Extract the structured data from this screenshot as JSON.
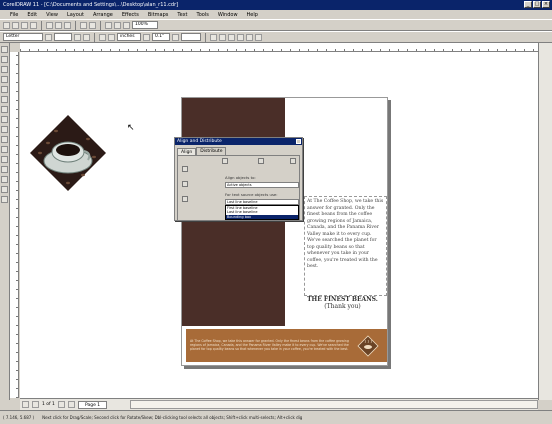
{
  "window": {
    "title": "CorelDRAW 11 - [C:\\Documents and Settings\\...\\Desktop\\alan_r11.cdr]",
    "buttons": [
      "_",
      "□",
      "×"
    ]
  },
  "menu": [
    "File",
    "Edit",
    "View",
    "Layout",
    "Arrange",
    "Effects",
    "Bitmaps",
    "Text",
    "Tools",
    "Window",
    "Help"
  ],
  "toolbar": {
    "zoom": "100%"
  },
  "property_bar": {
    "paper": "Letter",
    "units": "inches",
    "nudge": "0.1\""
  },
  "document": {
    "body_copy": "At The Coffee Shop, we take this answer for granted. Only the finest beans from the coffee growing regions of Jamaica, Canada, and the Panama River Valley make it to every cup. We've searched the planet for top quality beans so that whenever you take in your coffee, you're treated with the best.",
    "headline_1": "THE FINEST BEANS.",
    "headline_2": "(Thank you)",
    "footer_copy": "At The Coffee Shop, we take this answer for granted. Only the finest beans from the coffee growing regions of Jamaica, Canada, and the Panama River Valley make it to every cup. We've searched the planet for top quality beans so that whenever you take in your coffee, you're treated with the best."
  },
  "dialog": {
    "title": "Align and Distribute",
    "tabs": [
      "Align",
      "Distribute"
    ],
    "align_objects_to_label": "Align objects to:",
    "align_objects_to_value": "Active objects",
    "for_text_label": "For text source objects use:",
    "for_text_value": "Last line baseline",
    "options": [
      "First line baseline",
      "Last line baseline",
      "Bounding box"
    ],
    "selected_option_index": 2
  },
  "pages": {
    "counter": "1 of 1",
    "tab": "Page 1"
  },
  "status": {
    "coords": "( 7.146, 5.687 )",
    "hint": "Next click for Drag/Scale; Second click for Rotate/Skew; Dbl-clicking tool selects all objects; Shift+click multi-selects; Alt+click dig"
  },
  "colors": {
    "brown": "#4a2e28",
    "footer": "#a86b38",
    "titlebar": "#0a246a"
  }
}
